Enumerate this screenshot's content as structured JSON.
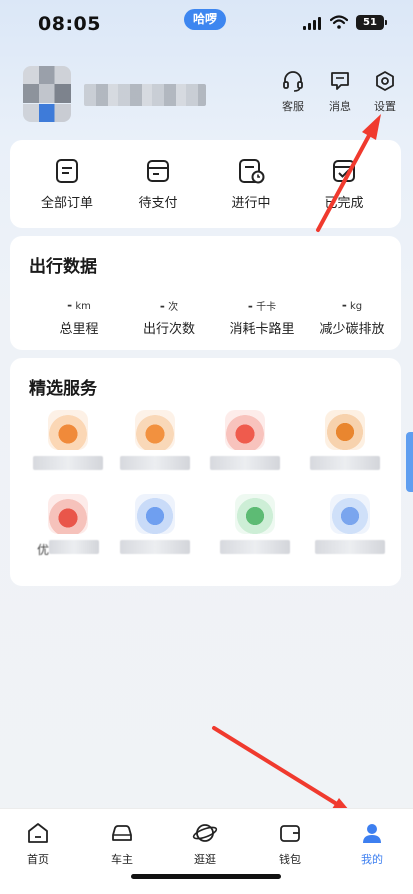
{
  "status_bar": {
    "time": "08:05",
    "pill": "哈啰",
    "battery": "51"
  },
  "header": {
    "actions": [
      {
        "label": "客服",
        "icon": "headset-icon"
      },
      {
        "label": "消息",
        "icon": "message-icon"
      },
      {
        "label": "设置",
        "icon": "settings-icon"
      }
    ]
  },
  "orders": {
    "items": [
      {
        "label": "全部订单",
        "icon": "all-orders-icon"
      },
      {
        "label": "待支付",
        "icon": "pending-payment-icon"
      },
      {
        "label": "进行中",
        "icon": "in-progress-icon"
      },
      {
        "label": "已完成",
        "icon": "completed-icon"
      }
    ]
  },
  "trip_data": {
    "title": "出行数据",
    "stats": [
      {
        "value": "-",
        "unit": "km",
        "label": "总里程"
      },
      {
        "value": "-",
        "unit": "次",
        "label": "出行次数"
      },
      {
        "value": "-",
        "unit": "千卡",
        "label": "消耗卡路里"
      },
      {
        "value": "-",
        "unit": "kg",
        "label": "减少碳排放"
      }
    ]
  },
  "services": {
    "title": "精选服务",
    "partial_label": "优"
  },
  "bottom_nav": {
    "items": [
      {
        "label": "首页",
        "icon": "home-icon"
      },
      {
        "label": "车主",
        "icon": "car-owner-icon"
      },
      {
        "label": "逛逛",
        "icon": "planet-icon"
      },
      {
        "label": "钱包",
        "icon": "wallet-icon"
      },
      {
        "label": "我的",
        "icon": "profile-icon"
      }
    ],
    "active": "我的"
  },
  "colors": {
    "accent": "#3d7ff0",
    "annotation": "#f03a2e"
  }
}
